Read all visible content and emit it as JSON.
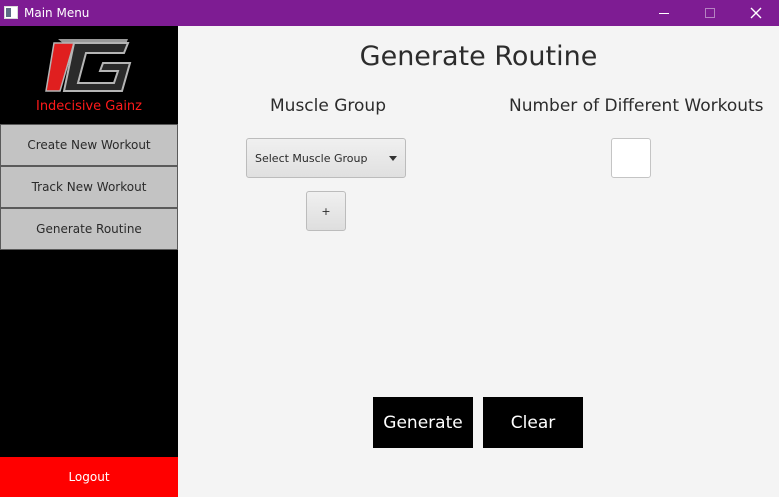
{
  "window": {
    "title": "Main Menu",
    "accent_color": "#7e1c93",
    "controls": [
      "minimize-icon",
      "maximize-icon",
      "close-icon"
    ],
    "close_glyph": "✕"
  },
  "sidebar": {
    "brand": "Indecisive Gainz",
    "brand_color": "#ff1a1a",
    "items": [
      {
        "label": "Create New Workout"
      },
      {
        "label": "Track New Workout"
      },
      {
        "label": "Generate Routine"
      }
    ],
    "logout_label": "Logout",
    "logout_color": "#ff0000"
  },
  "main": {
    "title": "Generate Routine",
    "muscle_group_label": "Muscle Group",
    "muscle_group_select": {
      "selected": "Select Muscle Group"
    },
    "add_label": "+",
    "workouts_label": "Number of Different Workouts",
    "workouts_value": "",
    "generate_label": "Generate",
    "clear_label": "Clear"
  }
}
